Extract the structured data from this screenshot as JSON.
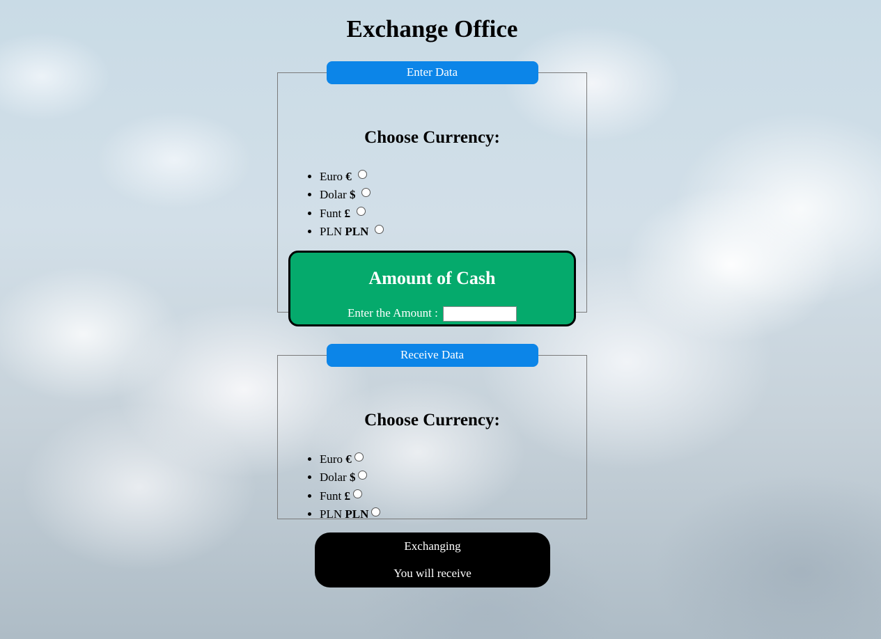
{
  "page": {
    "title": "Exchange Office"
  },
  "enter": {
    "legend": "Enter Data",
    "heading": "Choose Currency:",
    "currencies": [
      {
        "name": "Euro",
        "symbol": "€"
      },
      {
        "name": "Dolar",
        "symbol": "$"
      },
      {
        "name": "Funt",
        "symbol": "£"
      },
      {
        "name": "PLN",
        "symbol": "PLN"
      }
    ],
    "cash": {
      "title": "Amount of Cash",
      "label": "Enter the Amount :",
      "value": ""
    }
  },
  "receive": {
    "legend": "Receive Data",
    "heading": "Choose Currency:",
    "currencies": [
      {
        "name": "Euro",
        "symbol": "€"
      },
      {
        "name": "Dolar",
        "symbol": "$"
      },
      {
        "name": "Funt",
        "symbol": "£"
      },
      {
        "name": "PLN",
        "symbol": "PLN"
      }
    ]
  },
  "result": {
    "button_label": "Exchanging",
    "receive_label": "You will receive"
  },
  "colors": {
    "legend_bg": "#0c85e8",
    "cash_bg": "#05aa6c",
    "result_bg": "#000000"
  }
}
